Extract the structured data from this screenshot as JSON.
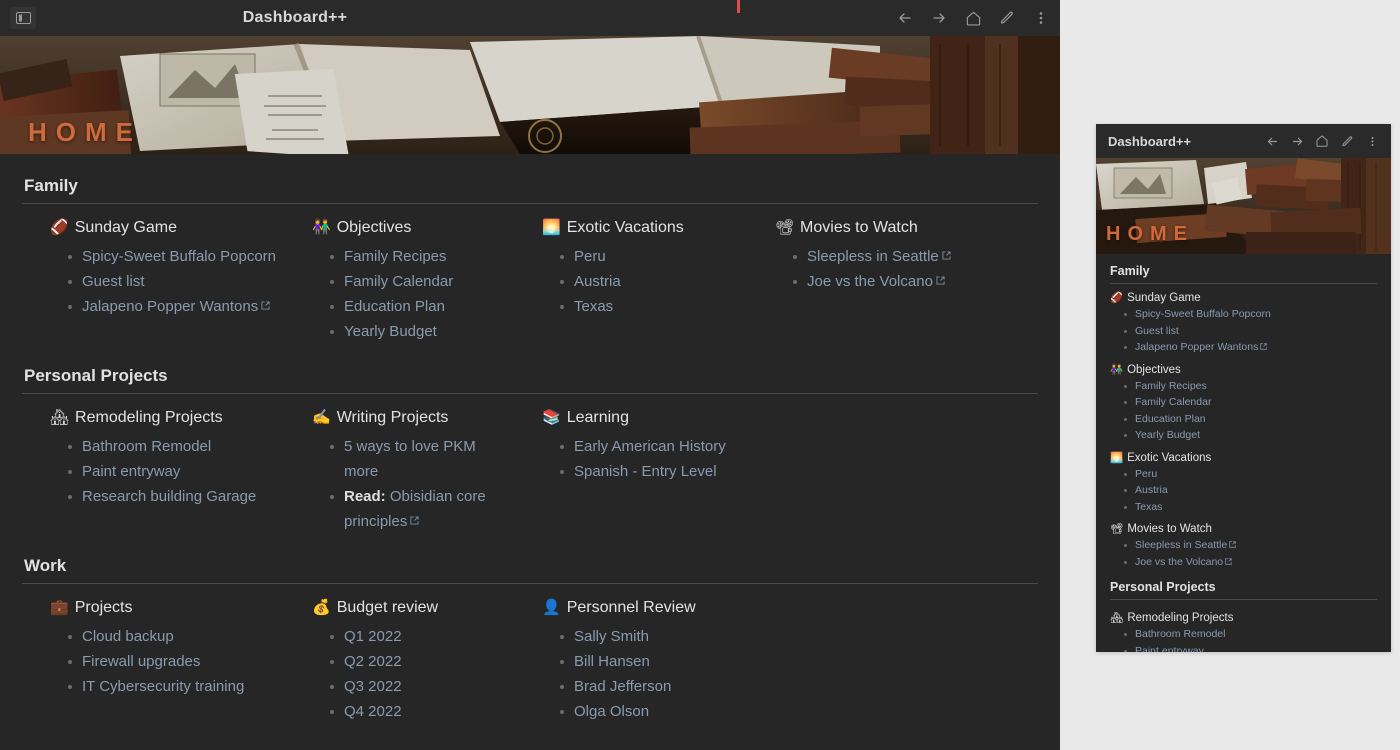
{
  "window": {
    "title": "Dashboard++",
    "sidebar_toggle_icon": "sidebar-toggle-icon",
    "nav": [
      {
        "name": "back-icon",
        "label": "Back"
      },
      {
        "name": "forward-icon",
        "label": "Forward"
      },
      {
        "name": "home-icon",
        "label": "Home"
      },
      {
        "name": "edit-pencil-icon",
        "label": "Edit"
      },
      {
        "name": "more-options-icon",
        "label": "More options"
      }
    ]
  },
  "banner": {
    "label": "HOME",
    "label_color": "#d06a3c",
    "image_alt": "antique-books-banner"
  },
  "theme": {
    "window_bg": "#262626",
    "titlebar_bg": "#2a2a2a",
    "page_bg": "#e9e9e9",
    "heading_color": "#e2e2e2",
    "link_color": "#8a9bb0",
    "rule_color": "#4a4a4a",
    "marker_color": "#e14b4b"
  },
  "sections": [
    {
      "title": "Family",
      "columns": [
        {
          "emoji": "🏈",
          "emoji_name": "football-icon",
          "title": "Sunday Game",
          "items": [
            {
              "text": "Spicy-Sweet Buffalo Popcorn",
              "link": true,
              "external": false
            },
            {
              "text": "Guest list",
              "link": true,
              "external": false
            },
            {
              "text": "Jalapeno Popper Wantons",
              "link": true,
              "external": true
            }
          ]
        },
        {
          "emoji": "👫",
          "emoji_name": "family-couple-icon",
          "title": "Objectives",
          "items": [
            {
              "text": "Family Recipes",
              "link": true,
              "external": false
            },
            {
              "text": "Family Calendar",
              "link": true,
              "external": false
            },
            {
              "text": "Education Plan",
              "link": true,
              "external": false
            },
            {
              "text": "Yearly Budget",
              "link": true,
              "external": false
            }
          ]
        },
        {
          "emoji": "🌅",
          "emoji_name": "sunrise-icon",
          "title": "Exotic Vacations",
          "items": [
            {
              "text": "Peru",
              "link": true,
              "external": false
            },
            {
              "text": "Austria",
              "link": true,
              "external": false
            },
            {
              "text": "Texas",
              "link": true,
              "external": false
            }
          ]
        },
        {
          "emoji": "📽",
          "emoji_name": "film-projector-icon",
          "title": "Movies to Watch",
          "items": [
            {
              "text": "Sleepless in Seattle",
              "link": true,
              "external": true
            },
            {
              "text": "Joe vs the Volcano",
              "link": true,
              "external": true
            }
          ]
        }
      ]
    },
    {
      "title": "Personal Projects",
      "columns": [
        {
          "emoji": "🏘",
          "emoji_name": "houses-icon",
          "title": "Remodeling Projects",
          "items": [
            {
              "text": "Bathroom Remodel",
              "link": true,
              "external": false
            },
            {
              "text": "Paint entryway",
              "link": true,
              "external": false
            },
            {
              "text": "Research building Garage",
              "link": true,
              "external": false
            }
          ]
        },
        {
          "emoji": "✍",
          "emoji_name": "writing-hand-icon",
          "title": "Writing Projects",
          "items": [
            {
              "text": "5 ways to love PKM more",
              "link": true,
              "external": false
            },
            {
              "prefix": "Read:",
              "text": "Obisidian core principles",
              "link": true,
              "external": true
            }
          ]
        },
        {
          "emoji": "📚",
          "emoji_name": "books-icon",
          "title": "Learning",
          "items": [
            {
              "text": "Early American History",
              "link": true,
              "external": false
            },
            {
              "text": "Spanish - Entry Level",
              "link": true,
              "external": false
            }
          ]
        }
      ]
    },
    {
      "title": "Work",
      "columns": [
        {
          "emoji": "💼",
          "emoji_name": "briefcase-icon",
          "title": "Projects",
          "items": [
            {
              "text": "Cloud backup",
              "link": true,
              "external": false
            },
            {
              "text": "Firewall upgrades",
              "link": true,
              "external": false
            },
            {
              "text": "IT Cybersecurity training",
              "link": true,
              "external": false
            }
          ]
        },
        {
          "emoji": "💰",
          "emoji_name": "money-bag-icon",
          "title": "Budget review",
          "items": [
            {
              "text": "Q1 2022",
              "link": true,
              "external": false
            },
            {
              "text": "Q2 2022",
              "link": true,
              "external": false
            },
            {
              "text": "Q3 2022",
              "link": true,
              "external": false
            },
            {
              "text": "Q4 2022",
              "link": true,
              "external": false
            }
          ]
        },
        {
          "emoji": "👤",
          "emoji_name": "person-bust-icon",
          "title": "Personnel Review",
          "items": [
            {
              "text": "Sally Smith",
              "link": true,
              "external": false
            },
            {
              "text": "Bill Hansen",
              "link": true,
              "external": false
            },
            {
              "text": "Brad Jefferson",
              "link": true,
              "external": false
            },
            {
              "text": "Olga Olson",
              "link": true,
              "external": false
            }
          ]
        }
      ]
    }
  ],
  "minimap": {
    "title": "Dashboard++",
    "banner_label": "HOME",
    "nav": [
      {
        "name": "back-icon",
        "label": "Back"
      },
      {
        "name": "forward-icon",
        "label": "Forward"
      },
      {
        "name": "home-icon",
        "label": "Home"
      },
      {
        "name": "edit-pencil-icon",
        "label": "Edit"
      },
      {
        "name": "more-options-icon",
        "label": "More options"
      }
    ],
    "sections": [
      {
        "title": "Family",
        "groups": [
          {
            "emoji": "🏈",
            "title": "Sunday Game",
            "items": [
              {
                "text": "Spicy-Sweet Buffalo Popcorn",
                "external": false
              },
              {
                "text": "Guest list",
                "external": false
              },
              {
                "text": "Jalapeno Popper Wantons",
                "external": true
              }
            ]
          },
          {
            "emoji": "👫",
            "title": "Objectives",
            "items": [
              {
                "text": "Family Recipes",
                "external": false
              },
              {
                "text": "Family Calendar",
                "external": false
              },
              {
                "text": "Education Plan",
                "external": false
              },
              {
                "text": "Yearly Budget",
                "external": false
              }
            ]
          },
          {
            "emoji": "🌅",
            "title": "Exotic Vacations",
            "items": [
              {
                "text": "Peru",
                "external": false
              },
              {
                "text": "Austria",
                "external": false
              },
              {
                "text": "Texas",
                "external": false
              }
            ]
          },
          {
            "emoji": "📽",
            "title": "Movies to Watch",
            "items": [
              {
                "text": "Sleepless in Seattle",
                "external": true
              },
              {
                "text": "Joe vs the Volcano",
                "external": true
              }
            ]
          }
        ]
      },
      {
        "title": "Personal Projects",
        "groups": [
          {
            "emoji": "🏘",
            "title": "Remodeling Projects",
            "items": [
              {
                "text": "Bathroom Remodel",
                "external": false
              },
              {
                "text": "Paint entryway",
                "external": false
              }
            ]
          }
        ]
      }
    ]
  }
}
